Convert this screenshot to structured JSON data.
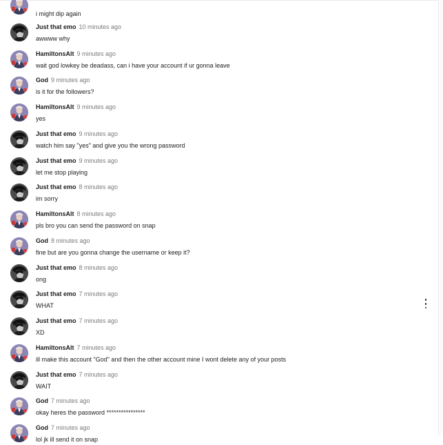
{
  "messages": [
    {
      "author": "",
      "time": "",
      "text": "i might dip again",
      "avatar": "hamilton"
    },
    {
      "author": "Just that emo",
      "time": "10 minutes ago",
      "text": "awwww why",
      "avatar": "emo"
    },
    {
      "author": "HamiltonsAlt",
      "time": "9 minutes ago",
      "text": "wait god lowkey be deadass, can i have your account if ur gonna leave",
      "avatar": "hamilton"
    },
    {
      "author": "God",
      "time": "9 minutes ago",
      "text": "is it for the followers?",
      "avatar": "hamilton"
    },
    {
      "author": "HamiltonsAlt",
      "time": "9 minutes ago",
      "text": "yes",
      "avatar": "hamilton"
    },
    {
      "author": "Just that emo",
      "time": "9 minutes ago",
      "text": "watch him say \"yes\" and give you the wrong password",
      "avatar": "emo"
    },
    {
      "author": "Just that emo",
      "time": "9 minutes ago",
      "text": "let me stop playing",
      "avatar": "emo"
    },
    {
      "author": "Just that emo",
      "time": "8 minutes ago",
      "text": "im sorry",
      "avatar": "emo"
    },
    {
      "author": "HamiltonsAlt",
      "time": "8 minutes ago",
      "text": "pls bro you can send the password on snap",
      "avatar": "hamilton"
    },
    {
      "author": "God",
      "time": "8 minutes ago",
      "text": "fine but are you gonna change the username or keep it?",
      "avatar": "hamilton"
    },
    {
      "author": "Just that emo",
      "time": "8 minutes ago",
      "text": "ong",
      "avatar": "emo"
    },
    {
      "author": "Just that emo",
      "time": "7 minutes ago",
      "text": "WHAT",
      "avatar": "emo",
      "hovered": true
    },
    {
      "author": "Just that emo",
      "time": "7 minutes ago",
      "text": "XD",
      "avatar": "emo"
    },
    {
      "author": "HamiltonsAlt",
      "time": "7 minutes ago",
      "text": "ill make this account \"God\" and then the other account mine I wont delete any of your posts",
      "avatar": "hamilton"
    },
    {
      "author": "Just that emo",
      "time": "7 minutes ago",
      "text": "WAIT",
      "avatar": "emo"
    },
    {
      "author": "God",
      "time": "7 minutes ago",
      "text": "okay heres the password ****************",
      "avatar": "hamilton"
    },
    {
      "author": "God",
      "time": "7 minutes ago",
      "text": "lol jk ill send it on snap",
      "avatar": "hamilton"
    }
  ],
  "icons": {
    "more": "more-vertical-icon",
    "avatar_emo": "dark-portrait-avatar",
    "avatar_hamilton": "colonial-portrait-avatar"
  },
  "colors": {
    "author": "#1b1b1b",
    "timestamp": "#7a7a7a",
    "message": "#1b1b1b",
    "background": "#ffffff"
  }
}
